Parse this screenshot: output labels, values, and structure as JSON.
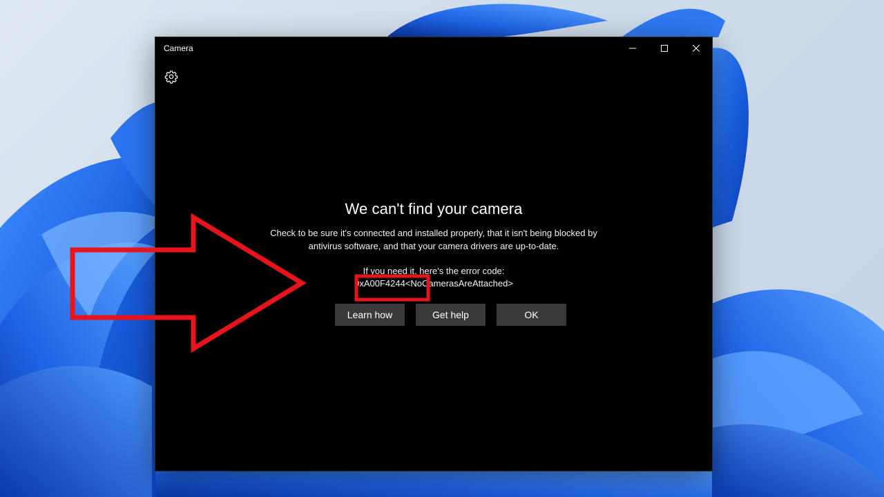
{
  "window": {
    "app_title": "Camera",
    "controls": [
      "minimize-icon",
      "maximize-icon",
      "close-icon"
    ],
    "settings_icon": "gear-icon"
  },
  "error": {
    "heading": "We can't find your camera",
    "message": "Check to be sure it's connected and installed properly, that it isn't being blocked by antivirus software, and that your camera drivers are up-to-date.",
    "code_intro": "If you need it, here's the error code:",
    "code": "0xA00F4244<NoCamerasAreAttached>"
  },
  "buttons": {
    "learn_how": "Learn how",
    "get_help": "Get help",
    "ok": "OK"
  },
  "colors": {
    "window_bg": "#000000",
    "button_bg": "#3a3a3a",
    "annotation_red": "#e8141c",
    "wallpaper_blue": "#1a5fe0"
  }
}
